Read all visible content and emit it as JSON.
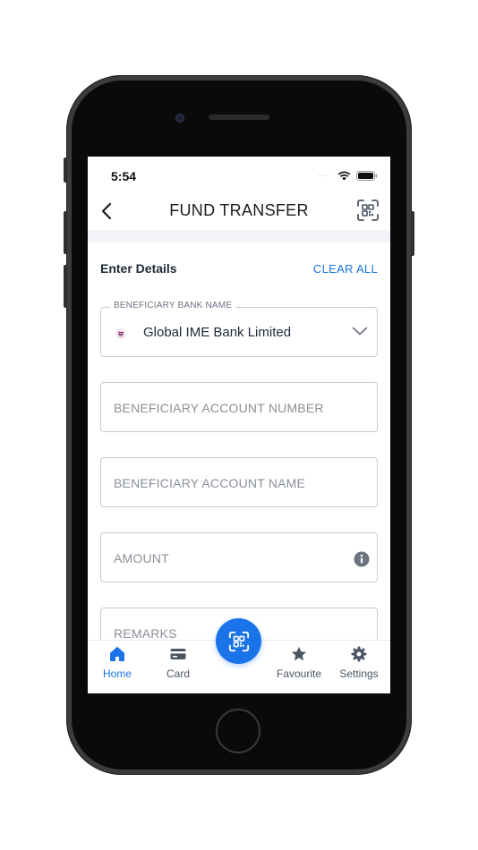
{
  "status_bar": {
    "time": "5:54",
    "signal": "····"
  },
  "header": {
    "title": "FUND TRANSFER",
    "back_icon": "chevron-left-icon",
    "scan_icon": "qr-scan-icon"
  },
  "section": {
    "title": "Enter Details",
    "clear_all_label": "CLEAR ALL"
  },
  "form": {
    "bank": {
      "legend": "BENEFICIARY BANK NAME",
      "value": "Global IME Bank Limited",
      "icon": "chevron-down-icon"
    },
    "account_number": {
      "placeholder": "BENEFICIARY ACCOUNT NUMBER"
    },
    "account_name": {
      "placeholder": "BENEFICIARY ACCOUNT NAME"
    },
    "amount": {
      "placeholder": "AMOUNT",
      "icon": "info-icon"
    },
    "remarks": {
      "placeholder": "REMARKS"
    }
  },
  "bottom_nav": {
    "items": [
      {
        "label": "Home",
        "icon": "home-icon",
        "active": true
      },
      {
        "label": "Card",
        "icon": "card-icon",
        "active": false
      },
      {
        "label": "Favourite",
        "icon": "star-icon",
        "active": false
      },
      {
        "label": "Settings",
        "icon": "gear-icon",
        "active": false
      }
    ],
    "center_action_icon": "qr-scan-icon"
  },
  "colors": {
    "accent": "#1a73e8",
    "text": "#1f2937",
    "placeholder": "#8a9099",
    "border": "#c7cbd1"
  }
}
